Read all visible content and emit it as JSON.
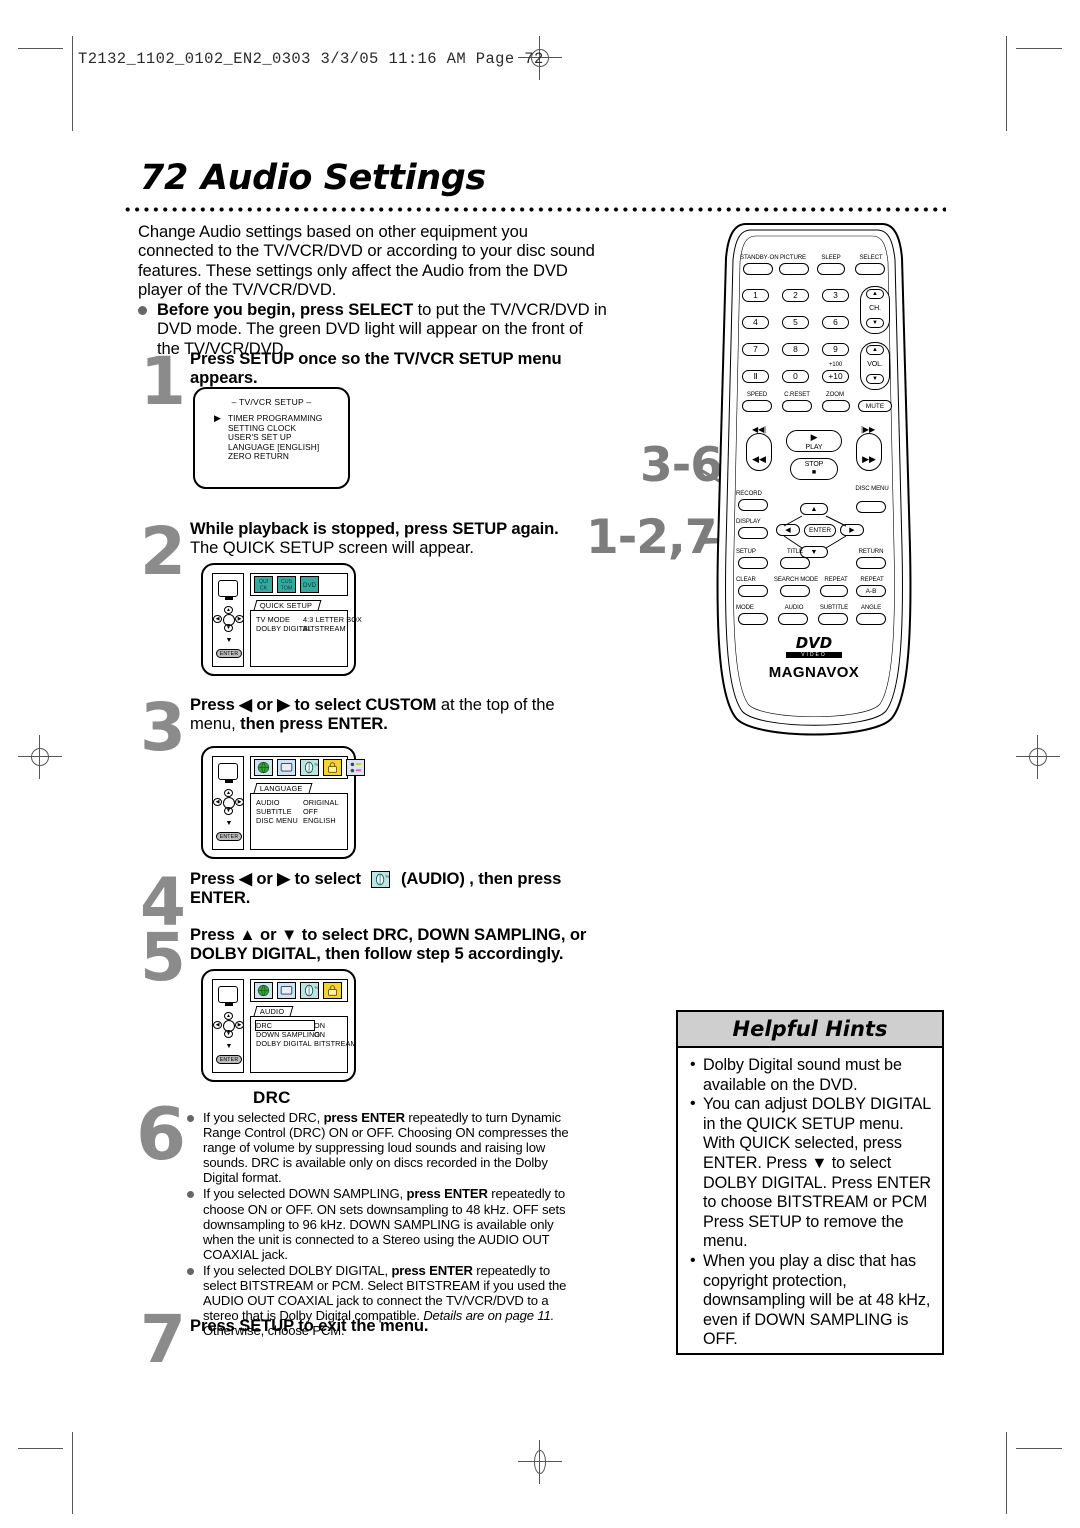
{
  "imposition": {
    "header": "T2132_1102_0102_EN2_0303  3/3/05  11:16 AM  Page 72"
  },
  "title": {
    "page_number": "72",
    "text": "Audio Settings"
  },
  "intro": {
    "paragraph": "Change Audio settings based on other equipment you connected to the TV/VCR/DVD or according to your disc sound features. These settings only affect the Audio from the DVD player of the TV/VCR/DVD.",
    "bullet_bold": "Before you begin, press SELECT",
    "bullet_rest": " to put the TV/VCR/DVD in DVD mode.  The green DVD light will appear on the front of the TV/VCR/DVD."
  },
  "steps": [
    {
      "number": "1",
      "bold": "Press SETUP once so the TV/VCR SETUP menu appears.",
      "rest": ""
    },
    {
      "number": "2",
      "bold": "While playback is stopped, press SETUP again.",
      "rest": "The QUICK SETUP screen will appear."
    },
    {
      "number": "3",
      "bold_a": "Press ◀ or ▶ to select CUSTOM",
      "mid": " at the top of the menu, ",
      "bold_b": "then press ENTER."
    },
    {
      "number": "4",
      "bold_a": "Press ◀ or ▶ to select",
      "bold_b": "(AUDIO) , then press ENTER."
    },
    {
      "number": "5",
      "bold": "Press ▲ or ▼ to select DRC, DOWN SAMPLING, or DOLBY DIGITAL, then follow step 5 accordingly."
    },
    {
      "number": "6",
      "heading": "DRC"
    },
    {
      "number": "7",
      "bold": "Press SETUP to exit the menu."
    }
  ],
  "step6_bullets": [
    {
      "a": "If you selected DRC, ",
      "b": "press ENTER",
      "c": " repeatedly to turn Dynamic Range Control (DRC) ON or OFF. Choosing ON compresses the range of volume by suppressing loud sounds and raising low sounds. DRC is available only on discs recorded in the Dolby Digital format."
    },
    {
      "a": "If you selected DOWN SAMPLING, ",
      "b": "press ENTER",
      "c": " repeatedly to choose ON or OFF. ON sets downsampling to 48 kHz. OFF sets downsampling to 96 kHz. DOWN SAMPLING is available only when the unit is connected to a Stereo using the AUDIO OUT COAXIAL jack."
    },
    {
      "a": "If you selected DOLBY DIGITAL, ",
      "b": "press ENTER",
      "c": " repeatedly to select BITSTREAM or PCM.  Select BITSTREAM if you used the AUDIO OUT COAXIAL jack to connect the TV/VCR/DVD to a stereo that is Dolby Digital compatible. ",
      "italic": "Details are on page 11.",
      "d": " Otherwise, choose PCM."
    }
  ],
  "osd_step1": {
    "title": "– TV/VCR SETUP –",
    "items": [
      "TIMER PROGRAMMING",
      "SETTING CLOCK",
      "USER'S SET UP",
      "LANGUAGE  [ENGLISH]",
      "ZERO RETURN"
    ],
    "cursor": "▶"
  },
  "osd_step2": {
    "tab": "QUICK SETUP",
    "icons": [
      "quick-setup-icon",
      "custom-setup-icon",
      "dvd-disc-icon"
    ],
    "rows": [
      {
        "label": "TV MODE",
        "value": "4:3 LETTER BOX"
      },
      {
        "label": "DOLBY DIGITAL",
        "value": "BITSTREAM"
      }
    ],
    "enter_label": "ENTER"
  },
  "osd_step3": {
    "tab": "LANGUAGE",
    "icons": [
      "globe-icon",
      "screen-icon",
      "audio-icon",
      "lock-icon",
      "custom-icon"
    ],
    "rows": [
      {
        "label": "AUDIO",
        "value": "ORIGINAL"
      },
      {
        "label": "SUBTITLE",
        "value": "OFF"
      },
      {
        "label": "DISC MENU",
        "value": "ENGLISH"
      }
    ],
    "enter_label": "ENTER"
  },
  "osd_step5": {
    "tab": "AUDIO",
    "icons": [
      "globe-icon",
      "screen-icon",
      "audio-icon",
      "lock-icon"
    ],
    "rows": [
      {
        "label": "DRC",
        "value": "ON",
        "selected": true
      },
      {
        "label": "DOWN SAMPLING",
        "value": "ON",
        "selected": false
      },
      {
        "label": "DOLBY DIGITAL",
        "value": "BITSTREAM",
        "selected": false
      }
    ],
    "enter_label": "ENTER"
  },
  "hints": {
    "title": "Helpful Hints",
    "items": [
      "Dolby Digital sound must be available on the DVD.",
      "You can adjust DOLBY DIGITAL in the QUICK SETUP menu. With QUICK selected, press ENTER. Press ▼ to select DOLBY DIGITAL. Press ENTER to choose BITSTREAM or PCM Press SETUP to remove the menu.",
      "When you play a disc that has copyright protection, downsampling will be at 48 kHz, even if DOWN SAMPLING is OFF."
    ]
  },
  "callouts": {
    "upper": "3-6",
    "lower": "1-2,7"
  },
  "remote": {
    "brand": "MAGNAVOX",
    "logo": "DVD",
    "logo_sub": "VIDEO",
    "top_row": [
      "STANDBY·ON",
      "PICTURE",
      "SLEEP",
      "SELECT"
    ],
    "keypad": [
      "1",
      "2",
      "3",
      "4",
      "5",
      "6",
      "7",
      "8",
      "9",
      "Ⅱ",
      "0",
      "+10"
    ],
    "plus100": "+100",
    "ch_label": "CH.",
    "vol_label": "VOL.",
    "row_speed": [
      "SPEED",
      "C.RESET",
      "ZOOM"
    ],
    "mute": "MUTE",
    "transport": [
      "PLAY",
      "STOP"
    ],
    "row_record": [
      "RECORD",
      "DISC MENU"
    ],
    "row_display": "DISPLAY",
    "enter": "ENTER",
    "row_setup": [
      "SETUP",
      "TITLE",
      "RETURN"
    ],
    "row_clear": [
      "CLEAR",
      "SEARCH MODE",
      "REPEAT",
      "REPEAT A-B"
    ],
    "row_mode": [
      "MODE",
      "AUDIO",
      "SUBTITLE",
      "ANGLE"
    ]
  },
  "colors": {
    "step_number": "#8b8b8b",
    "callout": "#7d7d7d",
    "hints_header": "#cfcfcf",
    "bullet": "#666666"
  }
}
